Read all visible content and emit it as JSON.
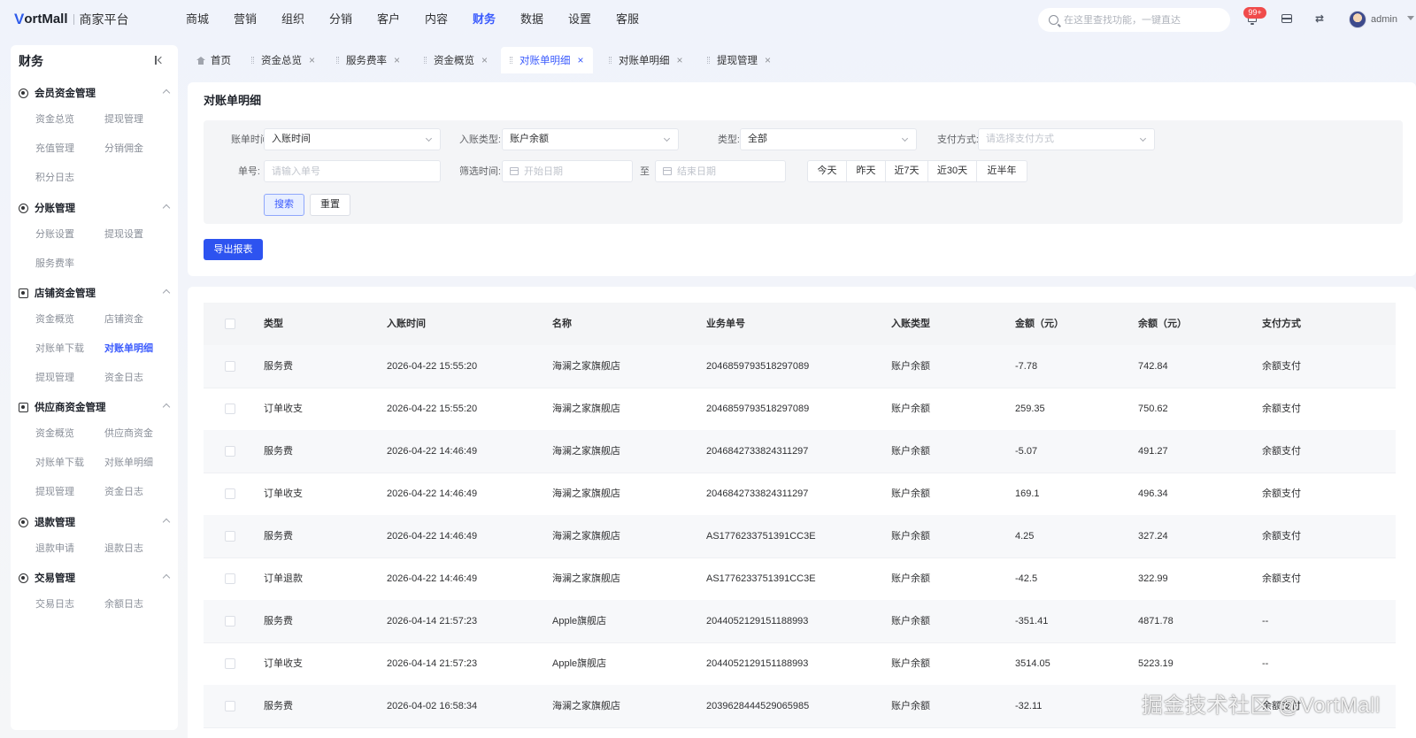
{
  "brand": {
    "logo_mark": "V",
    "logo_text": "ortMall",
    "subtitle": "商家平台"
  },
  "top_nav": [
    "商城",
    "营销",
    "组织",
    "分销",
    "客户",
    "内容",
    "财务",
    "数据",
    "设置",
    "客服"
  ],
  "top_nav_active": "财务",
  "search": {
    "placeholder": "在这里查找功能，一键直达"
  },
  "notifications": {
    "badge": "99+"
  },
  "user": {
    "name": "admin"
  },
  "sidebar": {
    "title": "财务",
    "groups": [
      {
        "label": "会员资金管理",
        "items": [
          "资金总览",
          "提现管理",
          "充值管理",
          "分销佣金",
          "积分日志"
        ]
      },
      {
        "label": "分账管理",
        "items": [
          "分账设置",
          "提现设置",
          "服务费率"
        ]
      },
      {
        "label": "店铺资金管理",
        "items": [
          "资金概览",
          "店铺资金",
          "对账单下载",
          "对账单明细",
          "提现管理",
          "资金日志"
        ]
      },
      {
        "label": "供应商资金管理",
        "items": [
          "资金概览",
          "供应商资金",
          "对账单下载",
          "对账单明细",
          "提现管理",
          "资金日志"
        ]
      },
      {
        "label": "退款管理",
        "items": [
          "退款申请",
          "退款日志"
        ]
      },
      {
        "label": "交易管理",
        "items": [
          "交易日志",
          "余额日志"
        ]
      }
    ],
    "active_item": "对账单明细"
  },
  "tabs": [
    "首页",
    "资金总览",
    "服务费率",
    "资金概览",
    "对账单明细",
    "对账单明细",
    "提现管理"
  ],
  "active_tab_index": 4,
  "page_title": "对账单明细",
  "filters": {
    "bill_time_label": "账单时间:",
    "bill_time_value": "入账时间",
    "entry_type_label": "入账类型:",
    "entry_type_value": "账户余额",
    "type_label": "类型:",
    "type_value": "全部",
    "pay_method_label": "支付方式:",
    "pay_method_placeholder": "请选择支付方式",
    "order_no_label": "单号:",
    "order_no_placeholder": "请输入单号",
    "filter_time_label": "筛选时间:",
    "start_date_placeholder": "开始日期",
    "range_sep": "至",
    "end_date_placeholder": "结束日期",
    "quick_ranges": [
      "今天",
      "昨天",
      "近7天",
      "近30天",
      "近半年"
    ],
    "search_label": "搜索",
    "reset_label": "重置"
  },
  "export_label": "导出报表",
  "table": {
    "columns": [
      "类型",
      "入账时间",
      "名称",
      "业务单号",
      "入账类型",
      "金额（元）",
      "余额（元）",
      "支付方式"
    ],
    "rows": [
      [
        "服务费",
        "2026-04-22 15:55:20",
        "海澜之家旗舰店",
        "2046859793518297089",
        "账户余额",
        "-7.78",
        "742.84",
        "余额支付"
      ],
      [
        "订单收支",
        "2026-04-22 15:55:20",
        "海澜之家旗舰店",
        "2046859793518297089",
        "账户余额",
        "259.35",
        "750.62",
        "余额支付"
      ],
      [
        "服务费",
        "2026-04-22 14:46:49",
        "海澜之家旗舰店",
        "2046842733824311297",
        "账户余额",
        "-5.07",
        "491.27",
        "余额支付"
      ],
      [
        "订单收支",
        "2026-04-22 14:46:49",
        "海澜之家旗舰店",
        "2046842733824311297",
        "账户余额",
        "169.1",
        "496.34",
        "余额支付"
      ],
      [
        "服务费",
        "2026-04-22 14:46:49",
        "海澜之家旗舰店",
        "AS1776233751391CC3E",
        "账户余额",
        "4.25",
        "327.24",
        "余额支付"
      ],
      [
        "订单退款",
        "2026-04-22 14:46:49",
        "海澜之家旗舰店",
        "AS1776233751391CC3E",
        "账户余额",
        "-42.5",
        "322.99",
        "余额支付"
      ],
      [
        "服务费",
        "2026-04-14 21:57:23",
        "Apple旗舰店",
        "2044052129151188993",
        "账户余额",
        "-351.41",
        "4871.78",
        "--"
      ],
      [
        "订单收支",
        "2026-04-14 21:57:23",
        "Apple旗舰店",
        "2044052129151188993",
        "账户余额",
        "3514.05",
        "5223.19",
        "--"
      ],
      [
        "服务费",
        "2026-04-02 16:58:34",
        "海澜之家旗舰店",
        "2039628444529065985",
        "账户余额",
        "-32.11",
        "",
        "余额支付"
      ]
    ]
  },
  "watermark": "掘金技术社区 @VortMall"
}
